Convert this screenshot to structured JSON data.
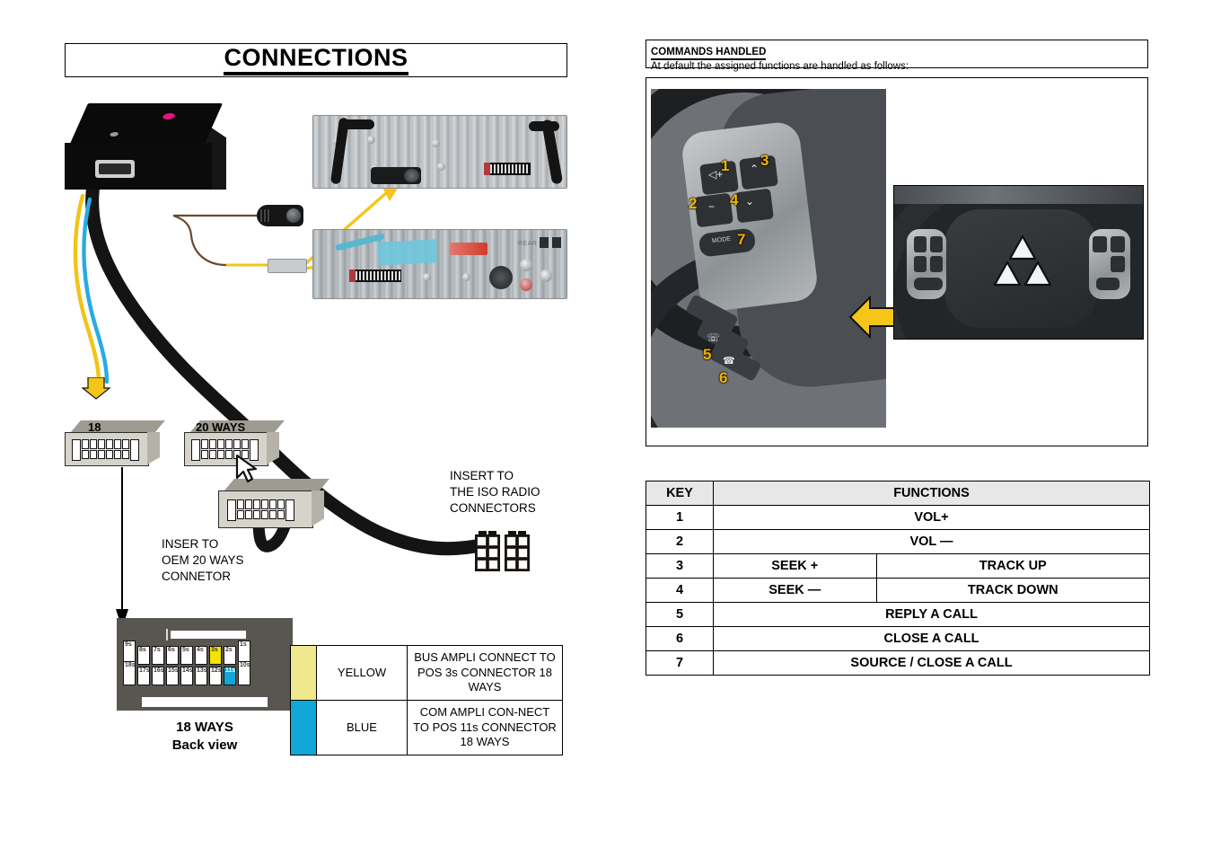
{
  "left_panel": {
    "title": "CONNECTIONS",
    "notes": {
      "insert_oem": "INSER TO\nOEM 20 WAYS\nCONNETOR",
      "insert_iso": "INSERT TO\nTHE ISO RADIO\nCONNECTORS"
    },
    "connectors": [
      {
        "label": "18",
        "name": "connector-18"
      },
      {
        "label": "20 WAYS",
        "name": "connector-20-ways"
      }
    ],
    "backview": {
      "caption_line1": "18 WAYS",
      "caption_line2": "Back view",
      "top_row": [
        "9s",
        "8s",
        "7s",
        "6s",
        "5s",
        "4s",
        "3s",
        "2s",
        "1s"
      ],
      "bottom_row": [
        "18s",
        "17s",
        "16s",
        "15s",
        "14s",
        "13s",
        "12s",
        "11s",
        "10s"
      ],
      "highlight_yellow_pin": "3s",
      "highlight_blue_pin": "11s"
    },
    "wire_legend": {
      "rows": [
        {
          "swatch": "yellow",
          "color": "YELLOW",
          "description": "BUS AMPLI CONNECT TO POS 3s  CONNECTOR 18 WAYS"
        },
        {
          "swatch": "blue",
          "color": "BLUE",
          "description": "COM AMPLI CON-NECT TO POS 11s CONNECTOR 18 WAYS"
        }
      ]
    },
    "radio_photo_labels": {
      "rear": "REAR"
    }
  },
  "right_panel": {
    "header_title": "COMMANDS HANDLED",
    "header_subtitle": "At default the assigned functions are handled as follows:",
    "wheel_callouts": [
      "1",
      "2",
      "3",
      "4",
      "5",
      "6",
      "7"
    ],
    "mode_button_label": "MODE",
    "table": {
      "headers": {
        "key": "KEY",
        "functions": "FUNCTIONS"
      },
      "rows": [
        {
          "key": "1",
          "fn": "VOL+",
          "fn2": null
        },
        {
          "key": "2",
          "fn": "VOL —",
          "fn2": null
        },
        {
          "key": "3",
          "fn": "SEEK +",
          "fn2": "TRACK UP"
        },
        {
          "key": "4",
          "fn": "SEEK —",
          "fn2": "TRACK DOWN"
        },
        {
          "key": "5",
          "fn": "REPLY A CALL",
          "fn2": null
        },
        {
          "key": "6",
          "fn": "CLOSE A CALL",
          "fn2": null
        },
        {
          "key": "7",
          "fn": "SOURCE / CLOSE A CALL",
          "fn2": null
        }
      ]
    }
  },
  "colors": {
    "wire_yellow": "#f0c419",
    "wire_blue": "#29abe2",
    "led_pink": "#e8127d",
    "arrow_yellow": "#f5c518",
    "table_header_grey": "#e7e7e7",
    "swatch_yellow": "#efe88c",
    "swatch_blue": "#11a7d8"
  }
}
